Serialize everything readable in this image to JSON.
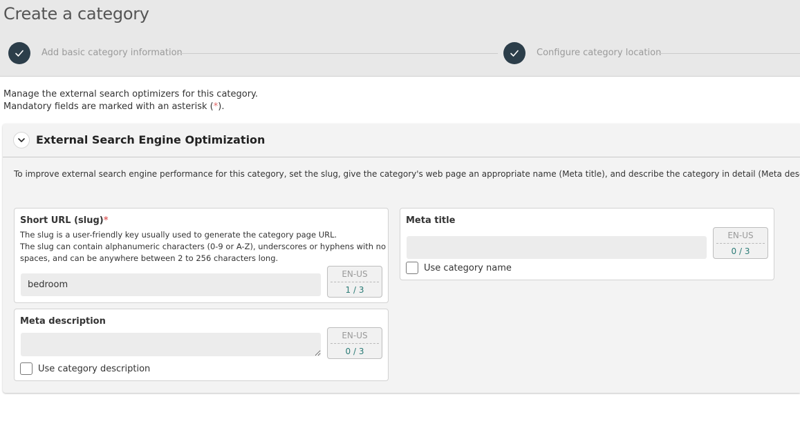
{
  "page": {
    "title": "Create a category"
  },
  "stepper": {
    "steps": [
      {
        "label": "Add basic category information",
        "state": "complete",
        "icon": "check-icon"
      },
      {
        "label": "Configure category location",
        "state": "complete",
        "icon": "check-icon"
      }
    ]
  },
  "intro": {
    "line1": "Manage the external search optimizers for this category.",
    "line2_prefix": "Mandatory fields are marked with an asterisk (",
    "asterisk": "*",
    "line2_suffix": ")."
  },
  "seo": {
    "title": "External Search Engine Optimization",
    "toggle_icon": "chevron-down-icon",
    "description": "To improve external search engine performance for this category, set the slug, give the category's web page an appropriate name (Meta title), and describe the category in detail (Meta description).",
    "slug": {
      "label": "Short URL (slug)",
      "required_mark": "*",
      "help1": "The slug is a user-friendly key usually used to generate the category page URL.",
      "help2": "The slug can contain alphanumeric characters (0-9 or A-Z), underscores or hyphens with no",
      "help3": "spaces, and can be anywhere between 2 to 256 characters long.",
      "value": "bedroom",
      "locale": "EN-US",
      "count": "1 / 3"
    },
    "meta_title": {
      "label": "Meta title",
      "value": "",
      "locale": "EN-US",
      "count": "0 / 3",
      "checkbox_label": "Use category name",
      "checked": false
    },
    "meta_description": {
      "label": "Meta description",
      "value": "",
      "locale": "EN-US",
      "count": "0 / 3",
      "checkbox_label": "Use category description",
      "checked": false
    }
  },
  "colors": {
    "header_bg": "#e8e8e8",
    "step_circle": "#2c3e4a",
    "count_text": "#2a7a75",
    "asterisk": "#e06666"
  }
}
